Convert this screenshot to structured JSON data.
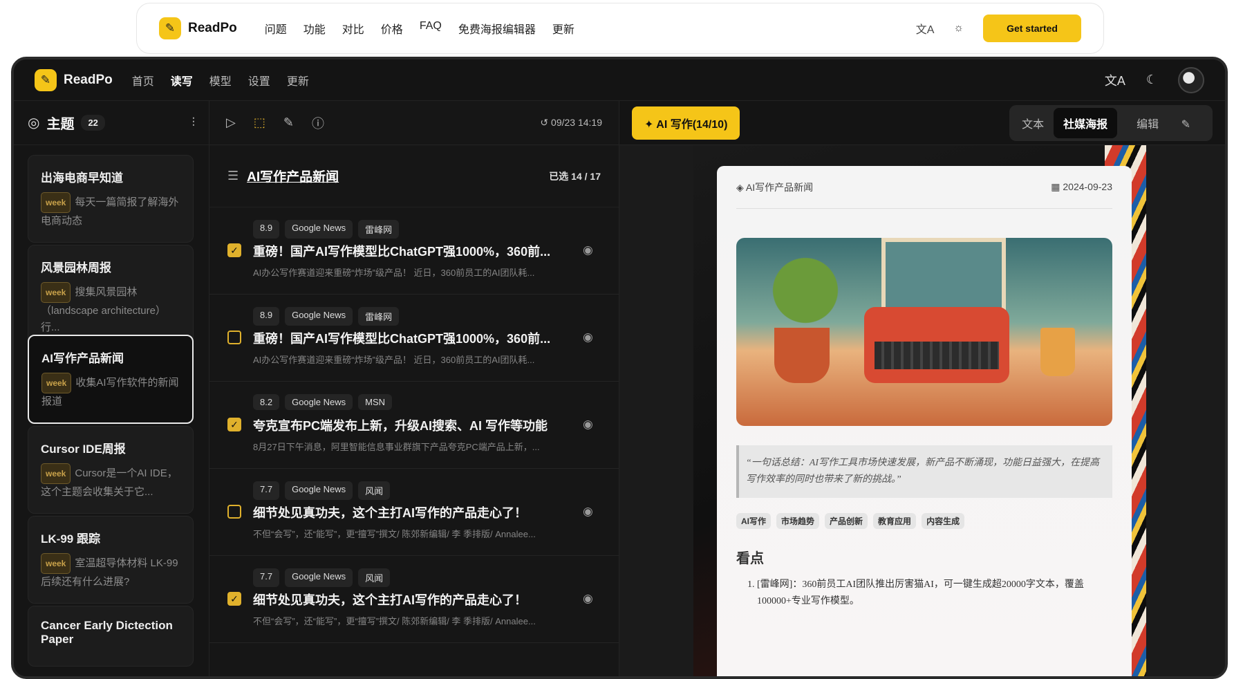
{
  "site": {
    "brand": "ReadPo",
    "nav": [
      "问题",
      "功能",
      "对比",
      "价格",
      "FAQ",
      "免费海报编辑器",
      "更新"
    ],
    "translate_icon": "translate-icon",
    "theme_icon": "sun-icon",
    "cta": "Get started"
  },
  "app": {
    "brand": "ReadPo",
    "nav": [
      "首页",
      "读写",
      "模型",
      "设置",
      "更新"
    ],
    "active_nav": "读写",
    "icons": [
      "translate-icon",
      "moon-icon",
      "avatar"
    ]
  },
  "sidebar": {
    "title": "主题",
    "count": "22",
    "items": [
      {
        "title": "出海电商早知道",
        "tag": "week",
        "desc": "每天一篇简报了解海外电商动态"
      },
      {
        "title": "风景园林周报",
        "tag": "week",
        "desc": "搜集风景园林（landscape architecture）行..."
      },
      {
        "title": "AI写作产品新闻",
        "tag": "week",
        "desc": "收集AI写作软件的新闻报道"
      },
      {
        "title": "Cursor IDE周报",
        "tag": "week",
        "desc": "Cursor是一个AI IDE，这个主题会收集关于它..."
      },
      {
        "title": "LK-99 跟踪",
        "tag": "week",
        "desc": "室温超导体材料 LK-99 后续还有什么进展?"
      },
      {
        "title": "Cancer Early Dictection Paper",
        "tag": "",
        "desc": ""
      }
    ]
  },
  "list": {
    "toolbar_time": "09/23 14:19",
    "title": "AI写作产品新闻",
    "selected": "已选 14 / 17",
    "items": [
      {
        "score": "8.9",
        "src1": "Google News",
        "src2": "雷峰网",
        "checked": true,
        "title": "重磅！国产AI写作模型比ChatGPT强1000%，360前...",
        "summary": "AI办公写作赛道迎来重磅“炸场”级产品！ 近日，360前员工的AI团队耗..."
      },
      {
        "score": "8.9",
        "src1": "Google News",
        "src2": "雷峰网",
        "checked": false,
        "title": "重磅！国产AI写作模型比ChatGPT强1000%，360前...",
        "summary": "AI办公写作赛道迎来重磅“炸场”级产品！ 近日，360前员工的AI团队耗..."
      },
      {
        "score": "8.2",
        "src1": "Google News",
        "src2": "MSN",
        "checked": true,
        "title": "夸克宣布PC端发布上新，升级AI搜索、AI 写作等功能",
        "summary": "8月27日下午消息，阿里智能信息事业群旗下产品夸克PC端产品上新，..."
      },
      {
        "score": "7.7",
        "src1": "Google News",
        "src2": "风闻",
        "checked": false,
        "title": "细节处见真功夫，这个主打AI写作的产品走心了！",
        "summary": "不但“会写”，还“能写”，更“擅写”撰文/ 陈郊新编辑/ 李 季排版/ Annalee..."
      },
      {
        "score": "7.7",
        "src1": "Google News",
        "src2": "风闻",
        "checked": true,
        "title": "细节处见真功夫，这个主打AI写作的产品走心了！",
        "summary": "不但“会写”，还“能写”，更“擅写”撰文/ 陈郊新编辑/ 李 季排版/ Annalee..."
      }
    ]
  },
  "right": {
    "ai_button": "AI 写作(14/10)",
    "segments": [
      "文本",
      "社媒海报",
      "编辑"
    ],
    "active_segment": "社媒海报",
    "poster": {
      "topic": "AI写作产品新闻",
      "date": "2024-09-23",
      "quote": "“一句话总结：AI写作工具市场快速发展，新产品不断涌现，功能日益强大，在提高写作效率的同时也带来了新的挑战。”",
      "tags": [
        "AI写作",
        "市场趋势",
        "产品创新",
        "教育应用",
        "内容生成"
      ],
      "section": "看点",
      "points": [
        "[雷峰网]：360前员工AI团队推出厉害猫AI，可一键生成超20000字文本，覆盖100000+专业写作模型。"
      ]
    }
  }
}
